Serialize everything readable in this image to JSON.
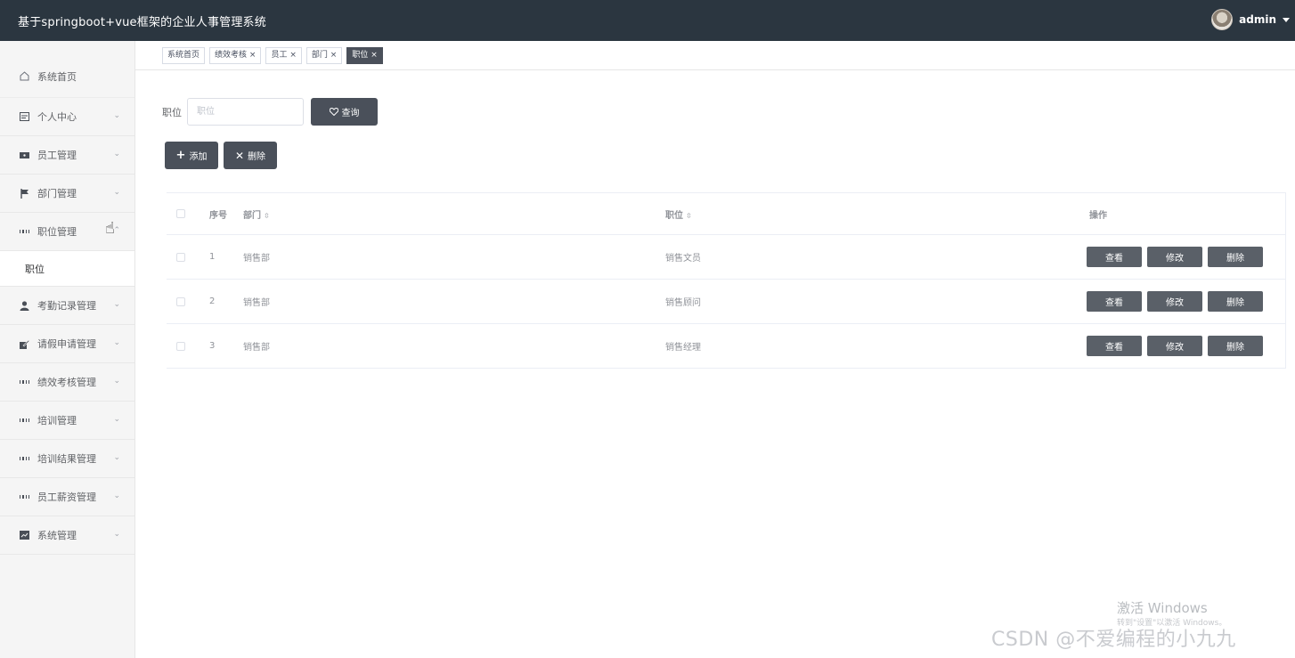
{
  "app": {
    "title": "基于springboot+vue框架的企业人事管理系统",
    "username": "admin"
  },
  "sidebar": {
    "items": [
      {
        "label": "系统首页",
        "icon": "home-icon",
        "expandable": false
      },
      {
        "label": "个人中心",
        "icon": "id-card-icon",
        "expandable": true
      },
      {
        "label": "员工管理",
        "icon": "ticket-icon",
        "expandable": true
      },
      {
        "label": "部门管理",
        "icon": "flag-icon",
        "expandable": true
      },
      {
        "label": "职位管理",
        "icon": "grid-icon",
        "expandable": true,
        "open": true,
        "sub": [
          "职位"
        ]
      },
      {
        "label": "考勤记录管理",
        "icon": "user-icon",
        "expandable": true
      },
      {
        "label": "请假申请管理",
        "icon": "edit-icon",
        "expandable": true
      },
      {
        "label": "绩效考核管理",
        "icon": "grid-icon",
        "expandable": true
      },
      {
        "label": "培训管理",
        "icon": "grid-icon",
        "expandable": true
      },
      {
        "label": "培训结果管理",
        "icon": "grid-icon",
        "expandable": true
      },
      {
        "label": "员工薪资管理",
        "icon": "grid-icon",
        "expandable": true
      },
      {
        "label": "系统管理",
        "icon": "chart-icon",
        "expandable": true
      }
    ]
  },
  "tabs": [
    {
      "label": "系统首页",
      "closable": false,
      "active": false
    },
    {
      "label": "绩效考核",
      "closable": true,
      "active": false
    },
    {
      "label": "员工",
      "closable": true,
      "active": false
    },
    {
      "label": "部门",
      "closable": true,
      "active": false
    },
    {
      "label": "职位",
      "closable": true,
      "active": true
    }
  ],
  "search": {
    "label": "职位",
    "placeholder": "职位",
    "value": "",
    "button_label": "查询"
  },
  "actions": {
    "add_label": "添加",
    "delete_label": "删除"
  },
  "table": {
    "headers": {
      "index": "序号",
      "dept": "部门",
      "position": "职位",
      "ops": "操作"
    },
    "rows": [
      {
        "index": "1",
        "dept": "销售部",
        "position": "销售文员"
      },
      {
        "index": "2",
        "dept": "销售部",
        "position": "销售顾问"
      },
      {
        "index": "3",
        "dept": "销售部",
        "position": "销售经理"
      }
    ],
    "row_actions": {
      "view": "查看",
      "edit": "修改",
      "delete": "删除"
    }
  },
  "watermark": {
    "activate_title": "激活 Windows",
    "activate_sub": "转到\"设置\"以激活 Windows。",
    "csdn": "CSDN @不爱编程的小九九"
  }
}
